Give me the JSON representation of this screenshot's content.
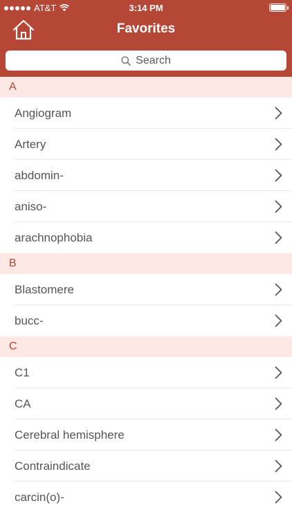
{
  "status_bar": {
    "carrier": "AT&T",
    "time": "3:14 PM"
  },
  "nav": {
    "title": "Favorites"
  },
  "search": {
    "placeholder": "Search"
  },
  "colors": {
    "header": "#b64635",
    "section_bg": "#fde8e6",
    "section_text": "#b64635"
  },
  "icons": {
    "home": "home-icon",
    "search": "magnifier-icon",
    "chevron": "chevron-right-icon"
  },
  "sections": [
    {
      "letter": "A",
      "items": [
        "Angiogram",
        "Artery",
        "abdomin-",
        "aniso-",
        "arachnophobia"
      ]
    },
    {
      "letter": "B",
      "items": [
        "Blastomere",
        "bucc-"
      ]
    },
    {
      "letter": "C",
      "items": [
        "C1",
        "CA",
        "Cerebral hemisphere",
        "Contraindicate",
        "carcin(o)-"
      ]
    }
  ]
}
